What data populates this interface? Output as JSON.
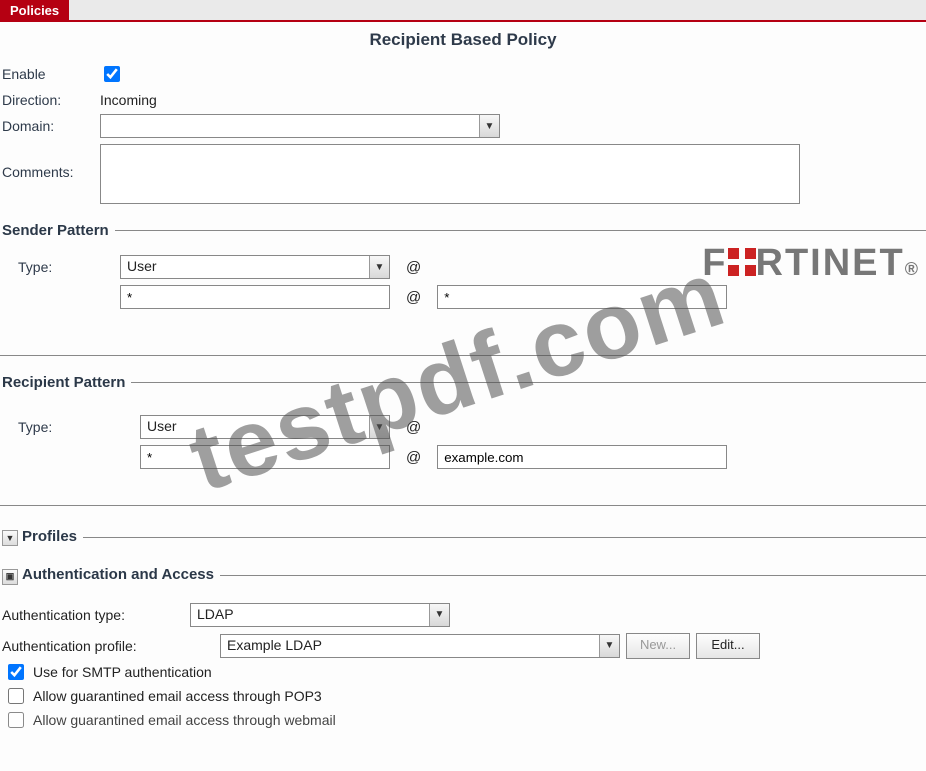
{
  "tab": "Policies",
  "page_title": "Recipient Based Policy",
  "labels": {
    "enable": "Enable",
    "direction": "Direction:",
    "domain": "Domain:",
    "comments": "Comments:"
  },
  "values": {
    "direction": "Incoming",
    "domain": "",
    "comments": ""
  },
  "brand": {
    "pre": "F",
    "mid_post": "RTINET"
  },
  "watermark": "testpdf.com",
  "sender_pattern": {
    "legend": "Sender Pattern",
    "type_label": "Type:",
    "type_value": "User",
    "user_value": "*",
    "domain_value": "*"
  },
  "recipient_pattern": {
    "legend": "Recipient Pattern",
    "type_label": "Type:",
    "type_value": "User",
    "user_value": "*",
    "domain_value": "example.com"
  },
  "profiles": {
    "legend": "Profiles"
  },
  "auth": {
    "legend": "Authentication and Access",
    "type_label": "Authentication type:",
    "type_value": "LDAP",
    "profile_label": "Authentication profile:",
    "profile_value": "Example LDAP",
    "new_btn": "New...",
    "edit_btn": "Edit...",
    "chk_smtp": "Use for SMTP authentication",
    "chk_pop3": "Allow guarantined email access through POP3",
    "chk_webmail": "Allow guarantined email access through webmail"
  }
}
